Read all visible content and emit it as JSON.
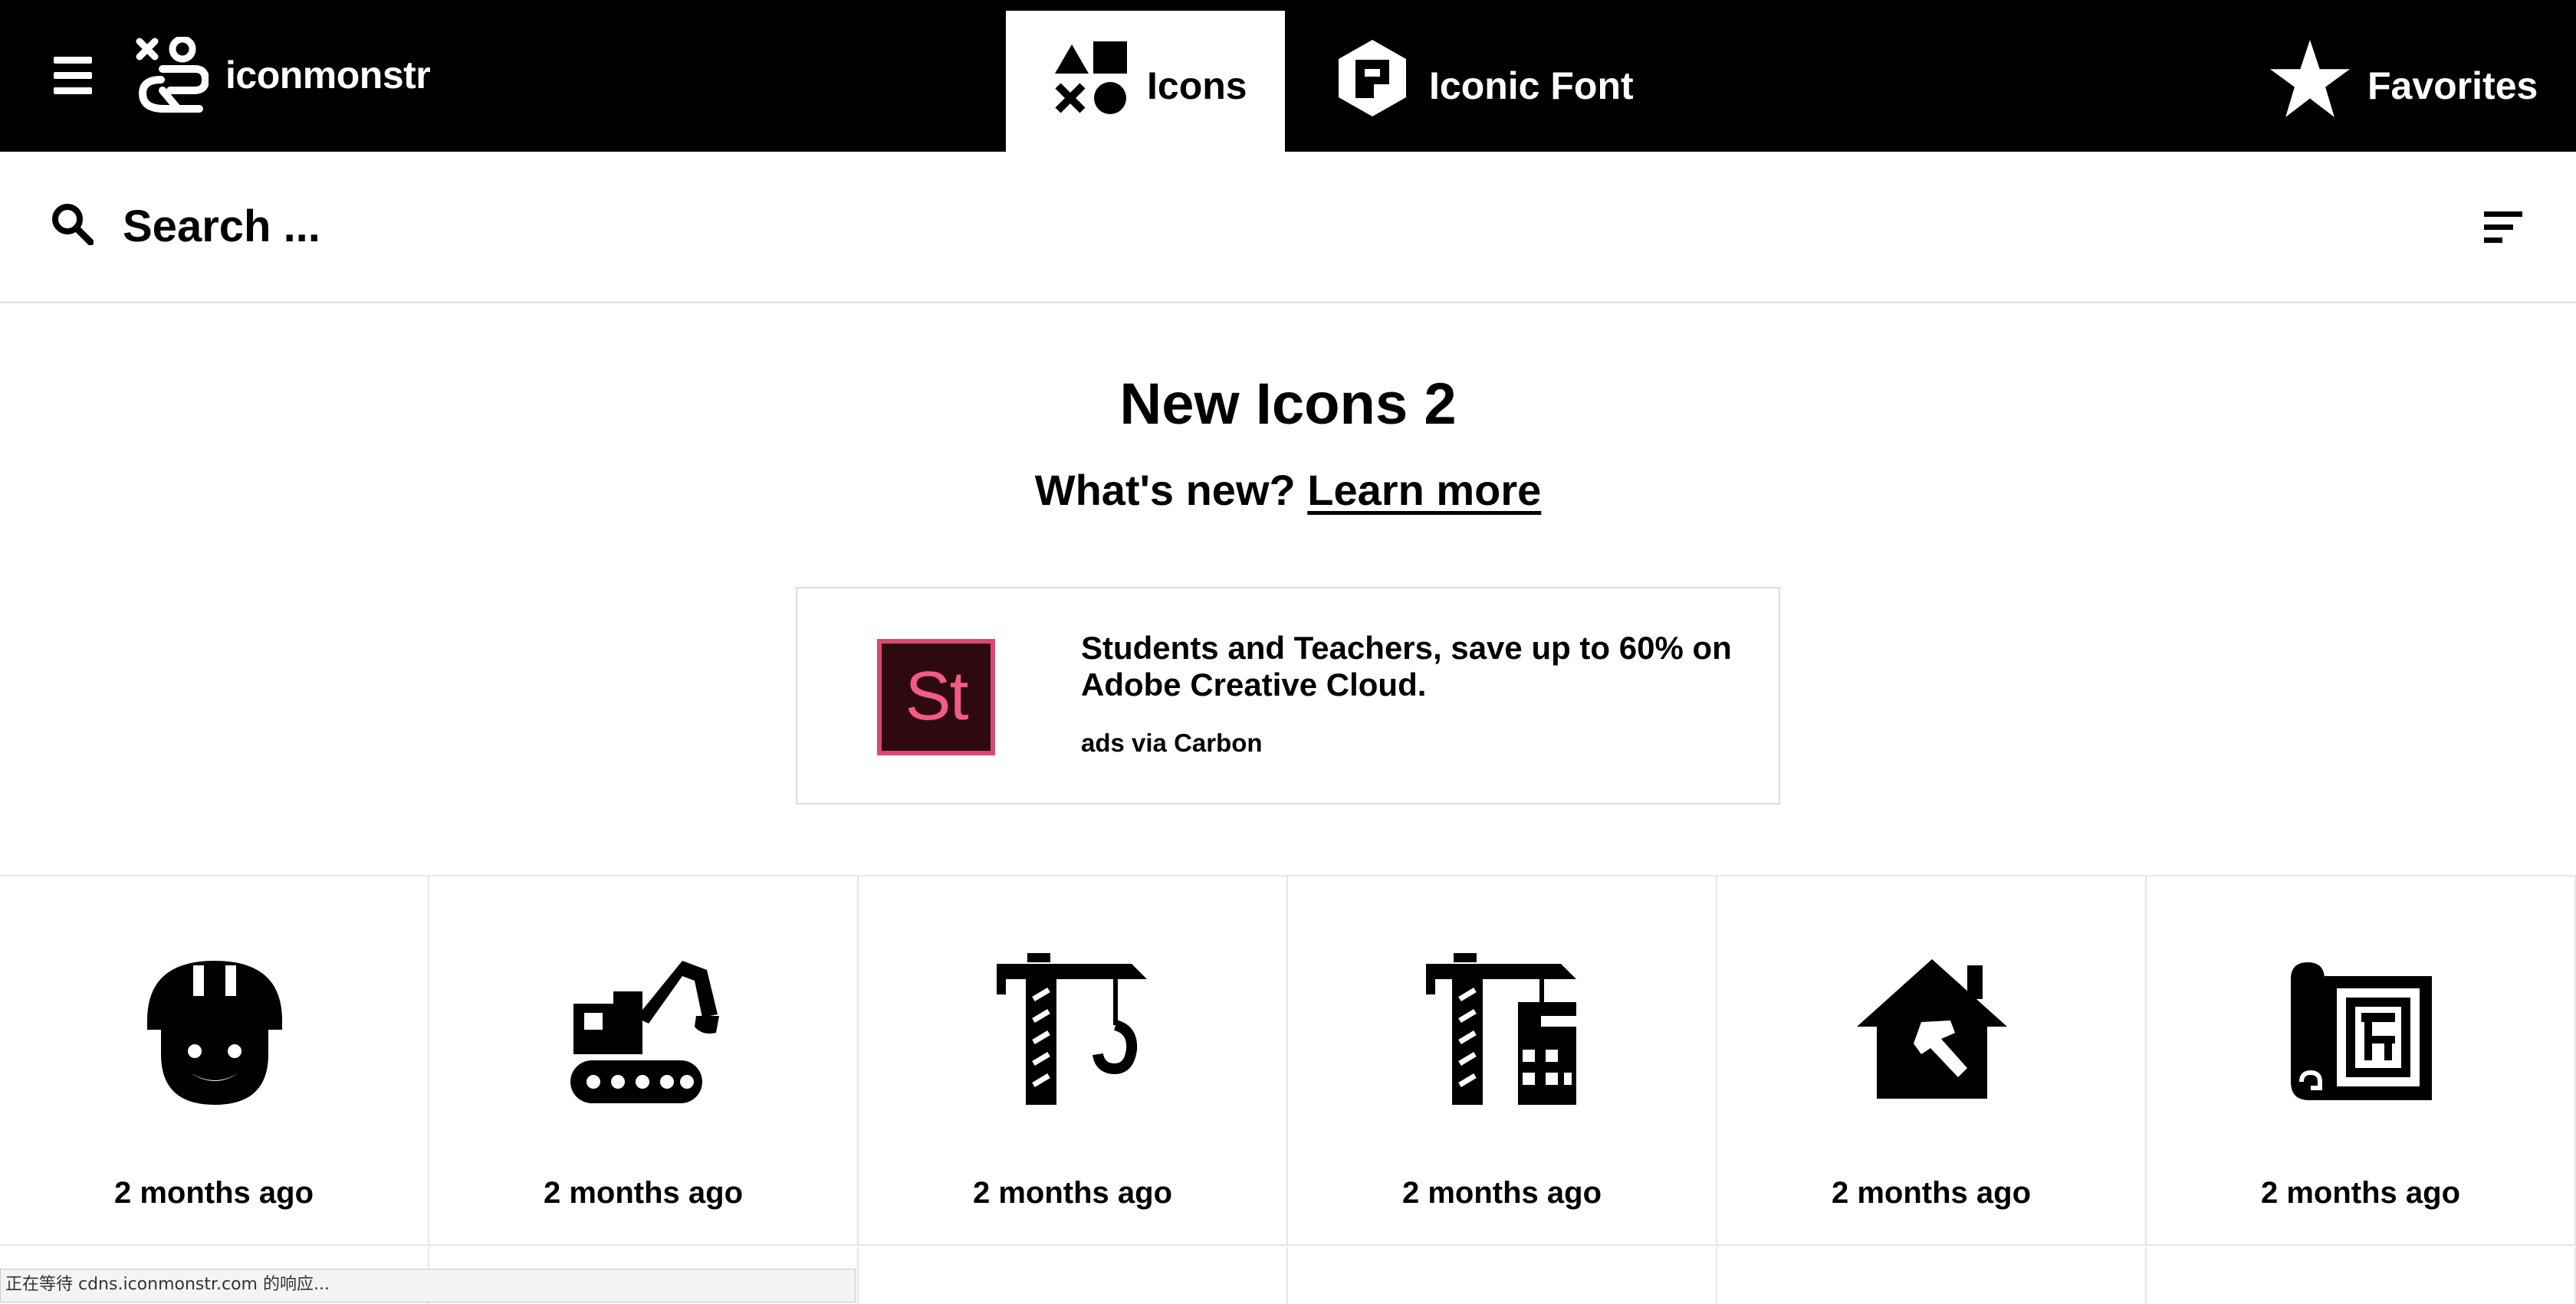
{
  "nav": {
    "brand": "iconmonstr",
    "tabs": [
      {
        "label": "Icons",
        "active": true
      },
      {
        "label": "Iconic Font",
        "active": false
      }
    ],
    "favorites_label": "Favorites"
  },
  "search": {
    "placeholder": "Search ..."
  },
  "hero": {
    "title": "New Icons 2",
    "subtitle_prefix": "What's new?",
    "link_label": "Learn more"
  },
  "ad": {
    "logo_text": "St",
    "text": "Students and Teachers, save up to 60% on Adobe Creative Cloud.",
    "via": "ads via Carbon"
  },
  "icons": [
    {
      "icon": "construction-worker-icon",
      "caption": "2 months ago"
    },
    {
      "icon": "excavator-icon",
      "caption": "2 months ago"
    },
    {
      "icon": "tower-crane-icon",
      "caption": "2 months ago"
    },
    {
      "icon": "crane-building-icon",
      "caption": "2 months ago"
    },
    {
      "icon": "house-hammer-icon",
      "caption": "2 months ago"
    },
    {
      "icon": "blueprint-icon",
      "caption": "2 months ago"
    }
  ],
  "status_text": "正在等待 cdns.iconmonstr.com 的响应...",
  "colors": {
    "nav_bg": "#000000",
    "accent_logo_bg": "#2e0a10",
    "accent_logo_fg": "#f25b83"
  }
}
